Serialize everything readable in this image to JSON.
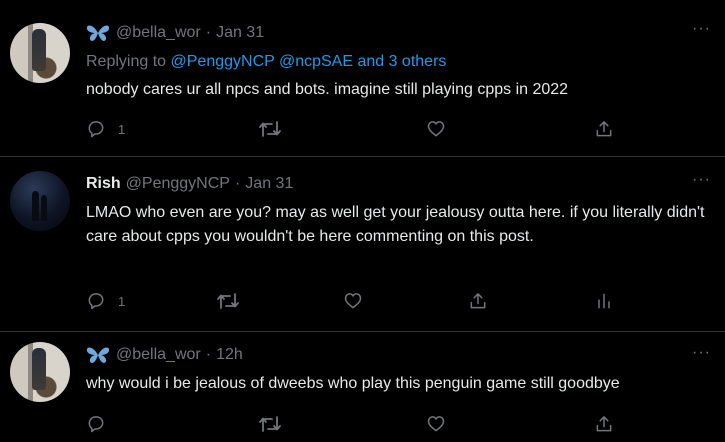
{
  "tweets": [
    {
      "handle": "@bella_wor",
      "date": "Jan 31",
      "reply_prefix": "Replying to ",
      "reply_mentions": "@PenggyNCP @ncpSAE and 3 others",
      "text": "nobody cares ur all npcs and bots. imagine still playing cpps in 2022",
      "reply_count": "1",
      "more": "···"
    },
    {
      "name": "Rish",
      "handle": "@PenggyNCP",
      "date": "Jan 31",
      "text": "LMAO who even are you? may as well get your jealousy outta here. if you literally didn't care about cpps you wouldn't be here commenting on this post.",
      "reply_count": "1",
      "more": "···"
    },
    {
      "handle": "@bella_wor",
      "date": "12h",
      "text": "why would i be jealous of dweebs who play this penguin game still goodbye",
      "more": "···"
    }
  ],
  "separator": "·"
}
